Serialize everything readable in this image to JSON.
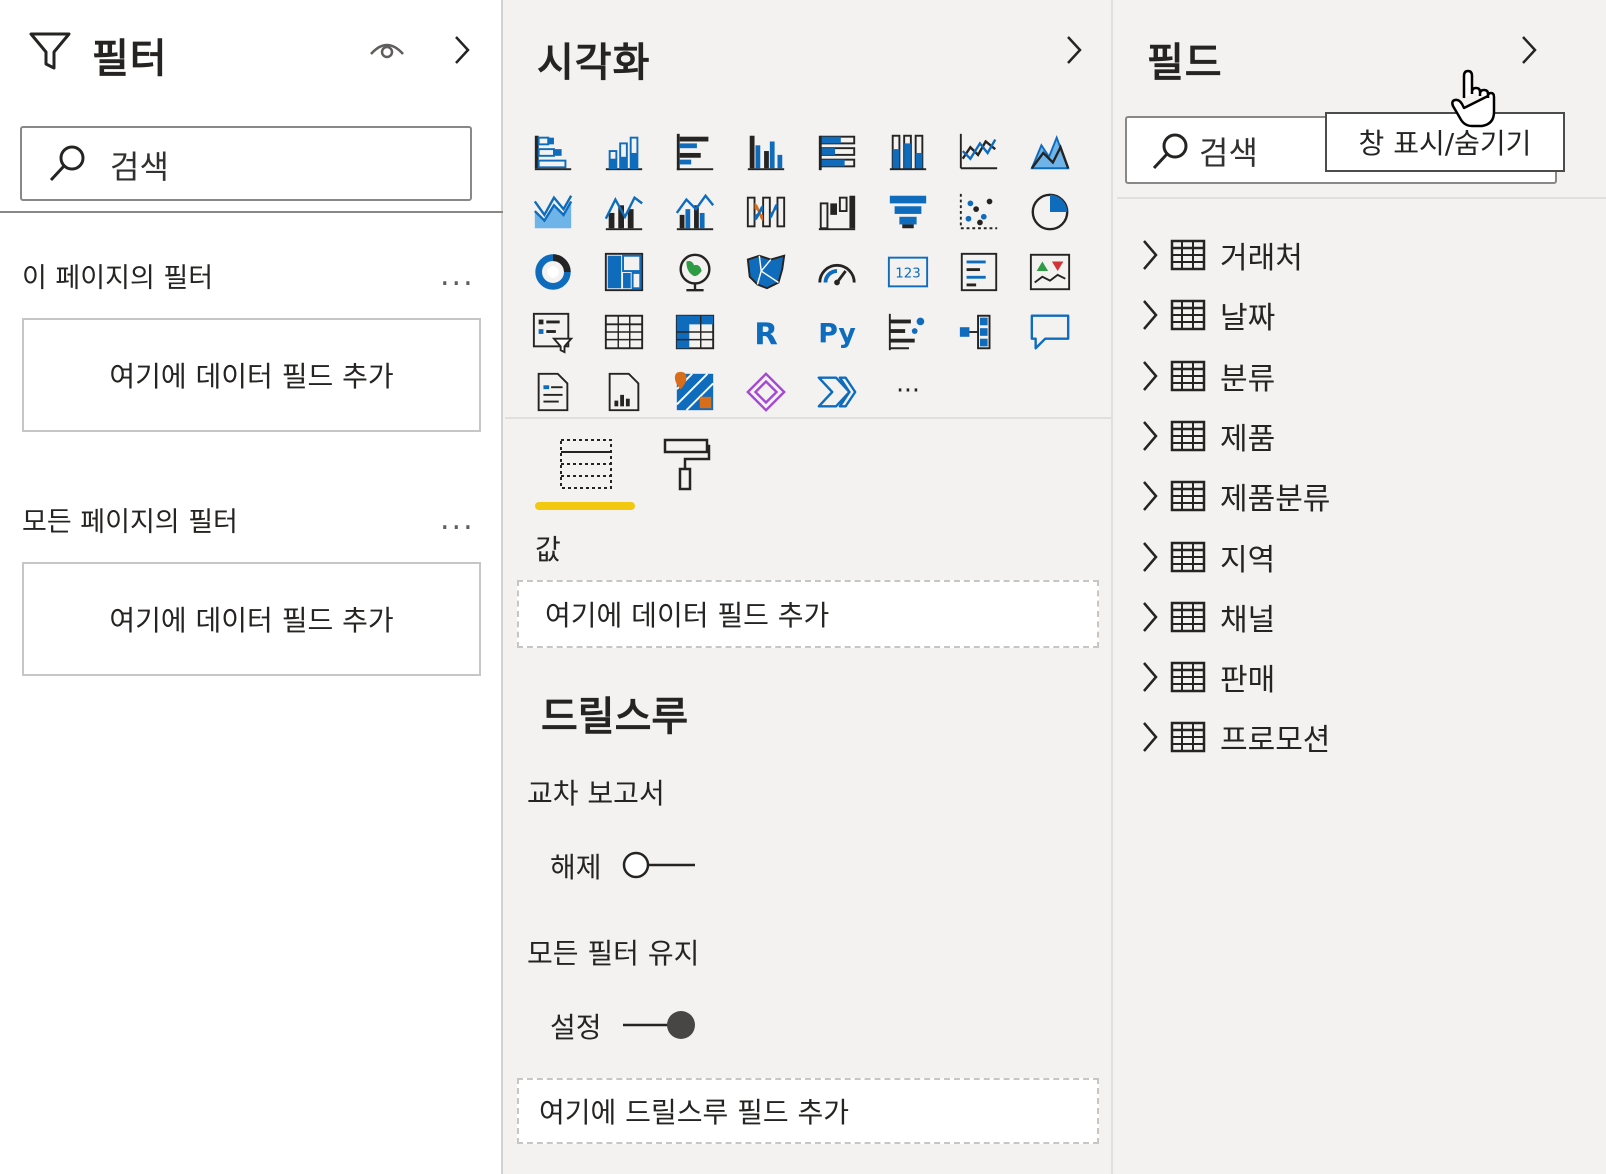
{
  "filters": {
    "title": "필터",
    "search": {
      "placeholder": "검색"
    },
    "sections": [
      {
        "title": "이 페이지의 필터",
        "more": "...",
        "well": "여기에 데이터 필드 추가"
      },
      {
        "title": "모든 페이지의 필터",
        "more": "...",
        "well": "여기에 데이터 필드 추가"
      }
    ]
  },
  "visualizations": {
    "title": "시각화",
    "icons": [
      "stacked-bar-chart-icon",
      "stacked-column-chart-icon",
      "clustered-bar-chart-icon",
      "clustered-column-chart-icon",
      "100-stacked-bar-chart-icon",
      "100-stacked-column-chart-icon",
      "line-chart-icon",
      "area-chart-icon",
      "stacked-area-chart-icon",
      "line-and-stacked-column-icon",
      "line-and-clustered-column-icon",
      "ribbon-chart-icon",
      "waterfall-chart-icon",
      "funnel-icon",
      "scatter-chart-icon",
      "pie-chart-icon",
      "donut-chart-icon",
      "treemap-icon",
      "map-icon",
      "filled-map-icon",
      "gauge-icon",
      "card-icon",
      "multi-row-card-icon",
      "kpi-icon",
      "slicer-icon",
      "table-icon",
      "matrix-icon",
      "r-visual-icon",
      "python-visual-icon",
      "key-influencers-icon",
      "decomposition-tree-icon",
      "qa-icon",
      "smart-narrative-icon",
      "paginated-report-icon",
      "arcgis-map-icon",
      "power-apps-icon",
      "power-automate-icon",
      "more-visuals-icon"
    ],
    "r_label": "R",
    "py_label": "Py",
    "more_label": "···",
    "values_label": "값",
    "values_well": "여기에 데이터 필드 추가",
    "drillthrough_title": "드릴스루",
    "cross_report_label": "교차 보고서",
    "cross_report_state": "해제",
    "cross_report_on": false,
    "keep_filters_label": "모든 필터 유지",
    "keep_filters_state": "설정",
    "keep_filters_on": true,
    "drill_well": "여기에 드릴스루 필드 추가",
    "accent": "#f2c811"
  },
  "fields": {
    "title": "필드",
    "search": {
      "placeholder": "검색"
    },
    "tooltip": "창 표시/숨기기",
    "tables": [
      "거래처",
      "날짜",
      "분류",
      "제품",
      "제품분류",
      "지역",
      "채널",
      "판매",
      "프로모션"
    ]
  }
}
